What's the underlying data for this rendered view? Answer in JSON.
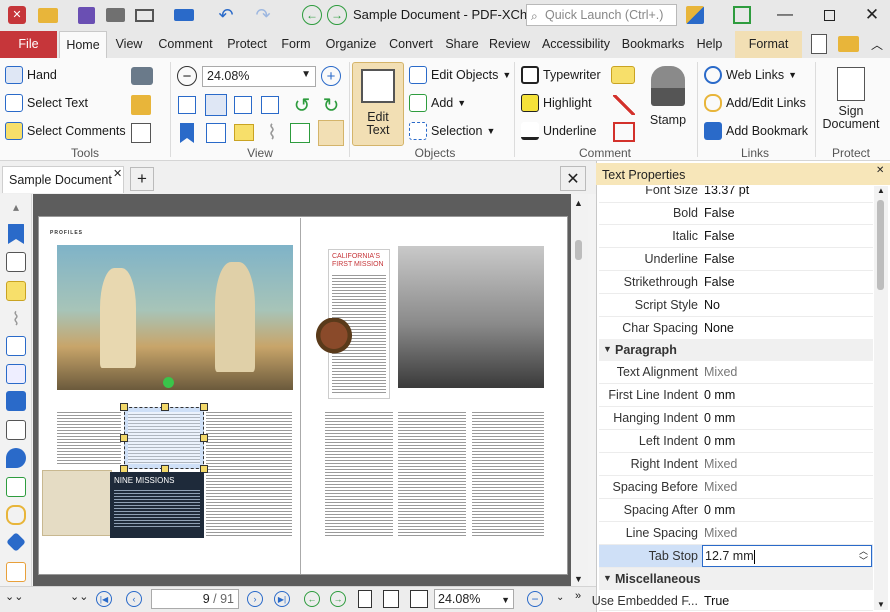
{
  "title_bar": {
    "document_title": "Sample Document - PDF-XCha...",
    "quick_launch_placeholder": "Quick Launch (Ctrl+.)"
  },
  "tabs": [
    "File",
    "Home",
    "View",
    "Comment",
    "Protect",
    "Form",
    "Organize",
    "Convert",
    "Share",
    "Review",
    "Accessibility",
    "Bookmarks",
    "Help",
    "Format"
  ],
  "ribbon": {
    "tools": {
      "group": "Tools",
      "hand": "Hand",
      "select_text": "Select Text",
      "select_comments": "Select Comments"
    },
    "view": {
      "group": "View",
      "zoom": "24.08%"
    },
    "objects": {
      "group": "Objects",
      "edit_text": "Edit Text",
      "edit_objects": "Edit Objects",
      "add": "Add",
      "selection": "Selection"
    },
    "comment": {
      "group": "Comment",
      "typewriter": "Typewriter",
      "highlight": "Highlight",
      "underline": "Underline",
      "stamp": "Stamp"
    },
    "links": {
      "group": "Links",
      "web_links": "Web Links",
      "add_edit_links": "Add/Edit Links",
      "add_bookmark": "Add Bookmark"
    },
    "protect": {
      "group": "Protect",
      "sign_document": "Sign Document"
    }
  },
  "document_tab": "Sample Document",
  "page_content": {
    "left_header": "PROFILES",
    "nine_missions": "NINE MISSIONS",
    "right_title": "CALIFORNIA'S FIRST MISSION"
  },
  "status_bar": {
    "page_current": "9",
    "page_total": "/ 91",
    "zoom": "24.08%"
  },
  "panel": {
    "title": "Text Properties",
    "font_size": {
      "label": "Font Size",
      "value": "13.37 pt"
    },
    "rows": [
      {
        "label": "Bold",
        "value": "False"
      },
      {
        "label": "Italic",
        "value": "False"
      },
      {
        "label": "Underline",
        "value": "False"
      },
      {
        "label": "Strikethrough",
        "value": "False"
      },
      {
        "label": "Script Style",
        "value": "No"
      },
      {
        "label": "Char Spacing",
        "value": "None"
      }
    ],
    "section_paragraph": "Paragraph",
    "paragraph_rows": [
      {
        "label": "Text Alignment",
        "value": "Mixed"
      },
      {
        "label": "First Line Indent",
        "value": "0 mm"
      },
      {
        "label": "Hanging Indent",
        "value": "0 mm"
      },
      {
        "label": "Left Indent",
        "value": "0 mm"
      },
      {
        "label": "Right Indent",
        "value": "Mixed"
      },
      {
        "label": "Spacing Before",
        "value": "Mixed"
      },
      {
        "label": "Spacing After",
        "value": "0 mm"
      },
      {
        "label": "Line Spacing",
        "value": "Mixed"
      }
    ],
    "tab_stop": {
      "label": "Tab Stop",
      "value": "12.7 mm"
    },
    "section_misc": "Miscellaneous",
    "misc_rows": [
      {
        "label": "Use Embedded F...",
        "value": "True"
      }
    ]
  },
  "colors": {
    "accent": "#c6363a",
    "panel_header": "#f7e6b9",
    "format_tab": "#f2dfb4",
    "selection": "#cfe0f7"
  }
}
